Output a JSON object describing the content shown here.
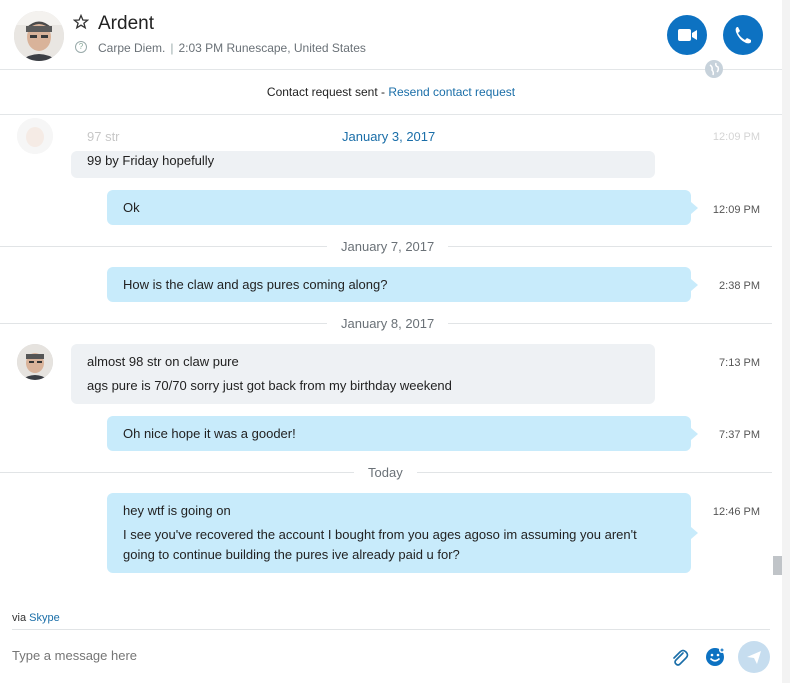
{
  "header": {
    "title": "Ardent",
    "mood": "Carpe Diem.",
    "local_time_location": "2:03 PM Runescape, United States",
    "video_call_label": "Video call",
    "audio_call_label": "Call"
  },
  "contact_request": {
    "text": "Contact request sent - ",
    "link": "Resend contact request"
  },
  "messages": {
    "partial_top": {
      "faded_text": "97 str",
      "faded_time": "12:09 PM",
      "text": "99 by Friday hopefully"
    },
    "sticky_date": "January 3, 2017",
    "m1": {
      "text": "Ok",
      "time": "12:09 PM"
    },
    "date2": "January 7, 2017",
    "m2": {
      "text": "How is the claw and ags pures coming along?",
      "time": "2:38 PM"
    },
    "date3": "January 8, 2017",
    "m3": {
      "line1": "almost 98 str on claw pure",
      "line2": "ags pure is 70/70 sorry just got back from my birthday weekend",
      "time": "7:13 PM"
    },
    "m4": {
      "text": "Oh nice hope it was a gooder!",
      "time": "7:37 PM"
    },
    "date4": "Today",
    "m5": {
      "line1": "hey wtf is going on",
      "line2": "I see you've recovered the account I bought from you ages agoso im assuming you aren't",
      "line3": "going to continue building the pures ive already paid u for?",
      "time": "12:46 PM"
    }
  },
  "footer": {
    "via_text": "via ",
    "via_link": "Skype",
    "compose_placeholder": "Type a message here"
  },
  "colors": {
    "accent": "#0d72c2",
    "link": "#1a6ea8",
    "outgoing_bubble": "#c8ebfb",
    "incoming_bubble": "#eef1f4"
  },
  "icons": [
    "star-icon",
    "status-icon",
    "video-camera-icon",
    "phone-icon",
    "globe-icon",
    "paperclip-icon",
    "emoji-icon",
    "send-icon"
  ]
}
